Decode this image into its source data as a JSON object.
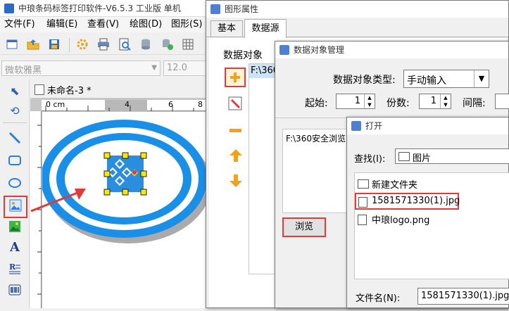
{
  "main": {
    "title": "中琅条码标签打印软件-V6.5.3 工业版 单机",
    "menu": [
      "文件(F)",
      "编辑(E)",
      "查看(V)",
      "绘图(D)",
      "图形(S)"
    ],
    "font_name": "微软雅黑",
    "font_size": "12.0",
    "doc_tab": "未命名-3 *",
    "ruler_label": "0 cm",
    "ruler_ticks": [
      "4",
      "6",
      "8"
    ]
  },
  "props": {
    "title": "图形属性",
    "tabs": [
      "基本",
      "数据源"
    ],
    "section_label": "数据对象",
    "list_item": "F:\\360"
  },
  "dm": {
    "title": "数据对象管理",
    "type_label": "数据对象类型:",
    "type_value": "手动输入",
    "start_label": "起始:",
    "start_value": "1",
    "copies_label": "份数:",
    "copies_value": "1",
    "interval_label": "间隔:",
    "text_content": "F:\\360安全浏览",
    "browse_label": "浏览"
  },
  "open": {
    "title": "打开",
    "lookin_label": "查找(I):",
    "lookin_value": "图片",
    "files": [
      "新建文件夹",
      "1581571330(1).jpg",
      "中琅logo.png"
    ],
    "filename_label": "文件名(N):",
    "filename_value": "1581571330(1).jpg"
  },
  "colors": {
    "accent_red": "#e03a3a",
    "ellipse_blue": "#1a8fe8",
    "title_text": "#333333"
  }
}
